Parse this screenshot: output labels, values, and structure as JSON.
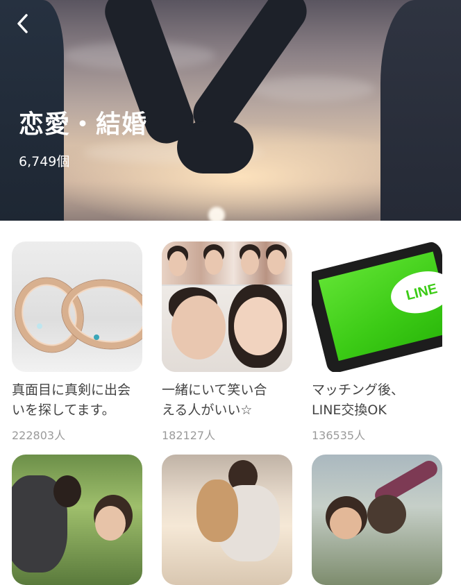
{
  "header": {
    "title": "恋愛・結婚",
    "count": "6,749個",
    "back_icon": "chevron-left-icon"
  },
  "cards": [
    {
      "title": "真面目に真剣に出会\nいを探してます。",
      "count": "222803人",
      "image": "wedding-rings"
    },
    {
      "title": "一緒にいて笑い合\nえる人がいい☆",
      "count": "182127人",
      "image": "couple-photo-collage"
    },
    {
      "title": "マッチング後、\nLINE交換OK",
      "count": "136535人",
      "image": "phone-line-app",
      "logo_text": "LINE"
    },
    {
      "title": "",
      "count": "",
      "image": "couple-in-park"
    },
    {
      "title": "",
      "count": "",
      "image": "couple-at-beach"
    },
    {
      "title": "",
      "count": "",
      "image": "couple-outdoors"
    }
  ],
  "colors": {
    "background": "#ffffff",
    "title_text": "#444444",
    "count_text": "#9a9a9a",
    "hero_text": "#ffffff",
    "line_green": "#3ccb16"
  }
}
